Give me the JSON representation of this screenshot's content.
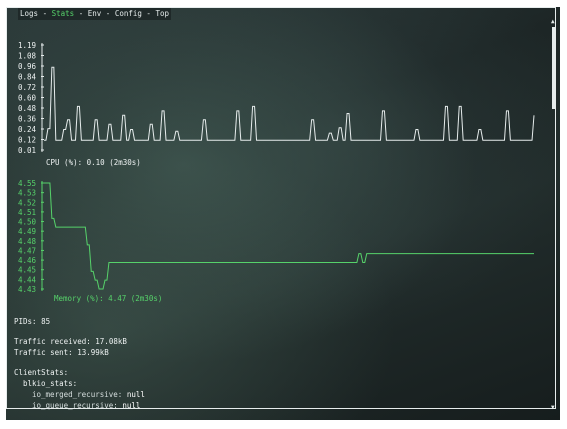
{
  "tabs": [
    {
      "label": "Logs",
      "active": false
    },
    {
      "label": "Stats",
      "active": true
    },
    {
      "label": "Env",
      "active": false
    },
    {
      "label": "Config",
      "active": false
    },
    {
      "label": "Top",
      "active": false
    }
  ],
  "tab_separator": "-",
  "colors": {
    "frame": "#e6ecec",
    "cpu": "#e6ecec",
    "memory": "#56d26a",
    "active_tab": "#56d26a",
    "text": "#eef2f2"
  },
  "chart_data": [
    {
      "type": "line",
      "label": "CPU (%): 0.10 (2m30s)",
      "y_ticks": [
        "1.19",
        "1.08",
        "0.96",
        "0.84",
        "0.72",
        "0.60",
        "0.48",
        "0.36",
        "0.24",
        "0.12",
        "0.01"
      ],
      "ylim": [
        0.01,
        1.19
      ],
      "x": [
        0,
        1,
        2,
        3,
        4,
        5,
        6,
        7,
        8,
        9,
        10,
        11,
        12,
        13,
        14,
        15,
        16,
        17,
        18,
        19,
        20,
        21,
        22,
        23,
        24,
        25,
        26,
        27,
        28,
        29,
        30,
        31,
        32,
        33,
        34,
        35,
        36,
        37,
        38,
        39,
        40,
        41,
        42,
        43,
        44,
        45,
        46,
        47,
        48,
        49,
        50,
        51,
        52,
        53,
        54,
        55,
        56,
        57,
        58,
        59,
        60,
        61,
        62,
        63,
        64,
        65,
        66,
        67,
        68,
        69,
        70,
        71,
        72,
        73,
        74,
        75,
        76,
        77,
        78,
        79,
        80,
        81,
        82,
        83,
        84,
        85,
        86,
        87,
        88,
        89,
        90,
        91,
        92,
        93,
        94,
        95,
        96,
        97,
        98,
        99,
        100,
        101,
        102,
        103,
        104,
        105,
        106,
        107,
        108,
        109,
        110,
        111,
        112,
        113,
        114,
        115,
        116,
        117,
        118,
        119,
        120,
        121,
        122,
        123,
        124,
        125,
        126,
        127,
        128,
        129,
        130,
        131,
        132,
        133,
        134,
        135,
        136,
        137,
        138,
        139,
        140,
        141,
        142,
        143,
        144,
        145,
        146,
        147,
        148,
        149,
        150,
        151,
        152,
        153,
        154,
        155,
        156,
        157,
        158,
        159,
        160,
        161,
        162,
        163,
        164,
        165,
        166,
        167,
        168,
        169,
        170,
        171,
        172,
        173,
        174,
        175,
        176,
        177,
        178,
        179,
        180,
        181,
        182,
        183,
        184,
        185,
        186,
        187,
        188,
        189,
        190,
        191,
        192,
        193,
        194,
        195,
        196,
        197,
        198,
        199,
        200,
        201,
        202,
        203,
        204,
        205,
        206,
        207,
        208,
        209,
        210,
        211,
        212,
        213,
        214,
        215,
        216,
        217,
        218,
        219,
        220,
        221,
        222,
        223,
        224,
        225,
        226,
        227,
        228,
        229,
        230,
        231,
        232,
        233,
        234,
        235,
        236,
        237,
        238,
        239,
        240,
        241,
        242,
        243,
        244,
        245,
        246,
        247,
        248,
        249
      ],
      "values": [
        0.12,
        0.12,
        0.25,
        0.25,
        0.94,
        0.94,
        0.12,
        0.12,
        0.12,
        0.12,
        0.24,
        0.24,
        0.35,
        0.35,
        0.12,
        0.12,
        0.12,
        0.5,
        0.5,
        0.12,
        0.12,
        0.12,
        0.12,
        0.12,
        0.12,
        0.12,
        0.35,
        0.35,
        0.12,
        0.12,
        0.12,
        0.12,
        0.12,
        0.3,
        0.3,
        0.12,
        0.12,
        0.12,
        0.12,
        0.12,
        0.4,
        0.4,
        0.12,
        0.12,
        0.24,
        0.24,
        0.12,
        0.12,
        0.12,
        0.12,
        0.12,
        0.12,
        0.12,
        0.12,
        0.3,
        0.3,
        0.12,
        0.12,
        0.12,
        0.12,
        0.45,
        0.45,
        0.12,
        0.12,
        0.12,
        0.12,
        0.12,
        0.22,
        0.22,
        0.12,
        0.12,
        0.12,
        0.12,
        0.12,
        0.12,
        0.12,
        0.12,
        0.12,
        0.12,
        0.12,
        0.12,
        0.35,
        0.35,
        0.12,
        0.12,
        0.12,
        0.12,
        0.12,
        0.12,
        0.12,
        0.12,
        0.12,
        0.12,
        0.12,
        0.12,
        0.12,
        0.12,
        0.12,
        0.45,
        0.45,
        0.12,
        0.12,
        0.12,
        0.12,
        0.12,
        0.12,
        0.5,
        0.5,
        0.12,
        0.12,
        0.12,
        0.12,
        0.12,
        0.12,
        0.12,
        0.12,
        0.12,
        0.12,
        0.12,
        0.12,
        0.12,
        0.12,
        0.12,
        0.12,
        0.12,
        0.12,
        0.12,
        0.12,
        0.12,
        0.12,
        0.12,
        0.12,
        0.12,
        0.12,
        0.12,
        0.12,
        0.35,
        0.35,
        0.12,
        0.12,
        0.12,
        0.12,
        0.12,
        0.12,
        0.12,
        0.2,
        0.2,
        0.12,
        0.12,
        0.12,
        0.26,
        0.26,
        0.12,
        0.12,
        0.42,
        0.42,
        0.12,
        0.12,
        0.12,
        0.12,
        0.12,
        0.12,
        0.12,
        0.12,
        0.12,
        0.12,
        0.12,
        0.12,
        0.12,
        0.12,
        0.12,
        0.12,
        0.45,
        0.45,
        0.12,
        0.12,
        0.12,
        0.12,
        0.12,
        0.12,
        0.12,
        0.12,
        0.12,
        0.12,
        0.12,
        0.12,
        0.12,
        0.12,
        0.12,
        0.24,
        0.24,
        0.12,
        0.12,
        0.12,
        0.12,
        0.12,
        0.12,
        0.12,
        0.12,
        0.12,
        0.12,
        0.12,
        0.12,
        0.12,
        0.5,
        0.5,
        0.12,
        0.12,
        0.12,
        0.12,
        0.12,
        0.5,
        0.5,
        0.12,
        0.12,
        0.12,
        0.12,
        0.12,
        0.12,
        0.12,
        0.12,
        0.24,
        0.24,
        0.12,
        0.12,
        0.12,
        0.12,
        0.12,
        0.12,
        0.12,
        0.12,
        0.12,
        0.12,
        0.12,
        0.12,
        0.45,
        0.45,
        0.12,
        0.12,
        0.12,
        0.12,
        0.12,
        0.12,
        0.12,
        0.12,
        0.12,
        0.12,
        0.12,
        0.12,
        0.4,
        0.4,
        0.12,
        0.12,
        0.12,
        0.12,
        0.12,
        0.12,
        0.12,
        0.12,
        0.12,
        0.12,
        0.12,
        0.12,
        0.3,
        0.3,
        0.12,
        0.12,
        0.12,
        0.12,
        0.12,
        0.12,
        0.12
      ]
    },
    {
      "type": "line",
      "label": "Memory (%): 4.47 (2m30s)",
      "y_ticks": [
        "4.55",
        "4.53",
        "4.52",
        "4.51",
        "4.50",
        "4.49",
        "4.48",
        "4.47",
        "4.46",
        "4.45",
        "4.44",
        "4.43"
      ],
      "ylim": [
        4.43,
        4.55
      ],
      "x": [
        0,
        1,
        2,
        3,
        4,
        5,
        6,
        7,
        8,
        9,
        10,
        11,
        12,
        13,
        14,
        15,
        16,
        17,
        18,
        19,
        20,
        21,
        22,
        23,
        24,
        25,
        26,
        27,
        28,
        29,
        30,
        31,
        32,
        33,
        34,
        35,
        36,
        37,
        38,
        39,
        40,
        41,
        42,
        43,
        44,
        45,
        46,
        47,
        48,
        49,
        50,
        51,
        52,
        53,
        54,
        55,
        56,
        57,
        58,
        59,
        60,
        61,
        62,
        63,
        64,
        65,
        66,
        67,
        68,
        69,
        70,
        71,
        72,
        73,
        74,
        75,
        76,
        77,
        78,
        79,
        80,
        81,
        82,
        83,
        84,
        85,
        86,
        87,
        88,
        89,
        90,
        91,
        92,
        93,
        94,
        95,
        96,
        97,
        98,
        99,
        100,
        101,
        102,
        103,
        104,
        105,
        106,
        107,
        108,
        109,
        110,
        111,
        112,
        113,
        114,
        115,
        116,
        117,
        118,
        119,
        120,
        121,
        122,
        123,
        124,
        125,
        126,
        127,
        128,
        129,
        130,
        131,
        132,
        133,
        134,
        135,
        136,
        137,
        138,
        139,
        140,
        141,
        142,
        143,
        144,
        145,
        146,
        147,
        148,
        149,
        150,
        151,
        152,
        153,
        154,
        155,
        156,
        157,
        158,
        159,
        160,
        161,
        162,
        163,
        164,
        165,
        166,
        167,
        168,
        169,
        170,
        171,
        172,
        173,
        174,
        175,
        176,
        177,
        178,
        179,
        180,
        181,
        182,
        183,
        184,
        185,
        186,
        187,
        188,
        189,
        190,
        191,
        192,
        193,
        194,
        195,
        196,
        197,
        198,
        199,
        200,
        201,
        202,
        203,
        204,
        205,
        206,
        207,
        208,
        209,
        210,
        211,
        212,
        213,
        214,
        215,
        216,
        217,
        218,
        219,
        220,
        221,
        222,
        223,
        224,
        225,
        226,
        227,
        228,
        229,
        230,
        231,
        232,
        233,
        234,
        235,
        236,
        237,
        238,
        239,
        240,
        241,
        242,
        243,
        244,
        245,
        246,
        247,
        248,
        249
      ],
      "values": [
        4.55,
        4.55,
        4.55,
        4.55,
        4.51,
        4.51,
        4.5,
        4.5,
        4.5,
        4.5,
        4.5,
        4.5,
        4.5,
        4.5,
        4.5,
        4.5,
        4.5,
        4.5,
        4.5,
        4.5,
        4.5,
        4.5,
        4.48,
        4.48,
        4.45,
        4.45,
        4.44,
        4.44,
        4.43,
        4.43,
        4.43,
        4.44,
        4.44,
        4.46,
        4.46,
        4.46,
        4.46,
        4.46,
        4.46,
        4.46,
        4.46,
        4.46,
        4.46,
        4.46,
        4.46,
        4.46,
        4.46,
        4.46,
        4.46,
        4.46,
        4.46,
        4.46,
        4.46,
        4.46,
        4.46,
        4.46,
        4.46,
        4.46,
        4.46,
        4.46,
        4.46,
        4.46,
        4.46,
        4.46,
        4.46,
        4.46,
        4.46,
        4.46,
        4.46,
        4.46,
        4.46,
        4.46,
        4.46,
        4.46,
        4.46,
        4.46,
        4.46,
        4.46,
        4.46,
        4.46,
        4.46,
        4.46,
        4.46,
        4.46,
        4.46,
        4.46,
        4.46,
        4.46,
        4.46,
        4.46,
        4.46,
        4.46,
        4.46,
        4.46,
        4.46,
        4.46,
        4.46,
        4.46,
        4.46,
        4.46,
        4.46,
        4.46,
        4.46,
        4.46,
        4.46,
        4.46,
        4.46,
        4.46,
        4.46,
        4.46,
        4.46,
        4.46,
        4.46,
        4.46,
        4.46,
        4.46,
        4.46,
        4.46,
        4.46,
        4.46,
        4.46,
        4.46,
        4.46,
        4.46,
        4.46,
        4.46,
        4.46,
        4.46,
        4.46,
        4.46,
        4.46,
        4.46,
        4.46,
        4.46,
        4.46,
        4.46,
        4.46,
        4.46,
        4.46,
        4.46,
        4.46,
        4.46,
        4.46,
        4.46,
        4.46,
        4.46,
        4.46,
        4.46,
        4.46,
        4.46,
        4.46,
        4.46,
        4.46,
        4.46,
        4.46,
        4.46,
        4.46,
        4.46,
        4.46,
        4.46,
        4.47,
        4.47,
        4.46,
        4.46,
        4.47,
        4.47,
        4.47,
        4.47,
        4.47,
        4.47,
        4.47,
        4.47,
        4.47,
        4.47,
        4.47,
        4.47,
        4.47,
        4.47,
        4.47,
        4.47,
        4.47,
        4.47,
        4.47,
        4.47,
        4.47,
        4.47,
        4.47,
        4.47,
        4.47,
        4.47,
        4.47,
        4.47,
        4.47,
        4.47,
        4.47,
        4.47,
        4.47,
        4.47,
        4.47,
        4.47,
        4.47,
        4.47,
        4.47,
        4.47,
        4.47,
        4.47,
        4.47,
        4.47,
        4.47,
        4.47,
        4.47,
        4.47,
        4.47,
        4.47,
        4.47,
        4.47,
        4.47,
        4.47,
        4.47,
        4.47,
        4.47,
        4.47,
        4.47,
        4.47,
        4.47,
        4.47,
        4.47,
        4.47,
        4.47,
        4.47,
        4.47,
        4.47,
        4.47,
        4.47,
        4.47,
        4.47,
        4.47,
        4.47,
        4.47,
        4.47,
        4.47,
        4.47,
        4.47,
        4.47,
        4.47,
        4.47,
        4.47,
        4.47,
        4.47,
        4.47,
        4.47,
        4.47
      ]
    }
  ],
  "stats": {
    "pids": "PIDs: 85",
    "traffic_received": "Traffic received: 17.08kB",
    "traffic_sent": "Traffic sent: 13.99kB",
    "client_stats_heading": "ClientStats:",
    "blkio_heading": "blkio_stats:",
    "io_merged_key": "io_merged_recursive:",
    "io_merged_val": "null",
    "io_queue_key": "io_queue_recursive:",
    "io_queue_val": "null"
  },
  "scrollbar": {
    "up": "▲",
    "down": "▼",
    "position": 0.0
  }
}
